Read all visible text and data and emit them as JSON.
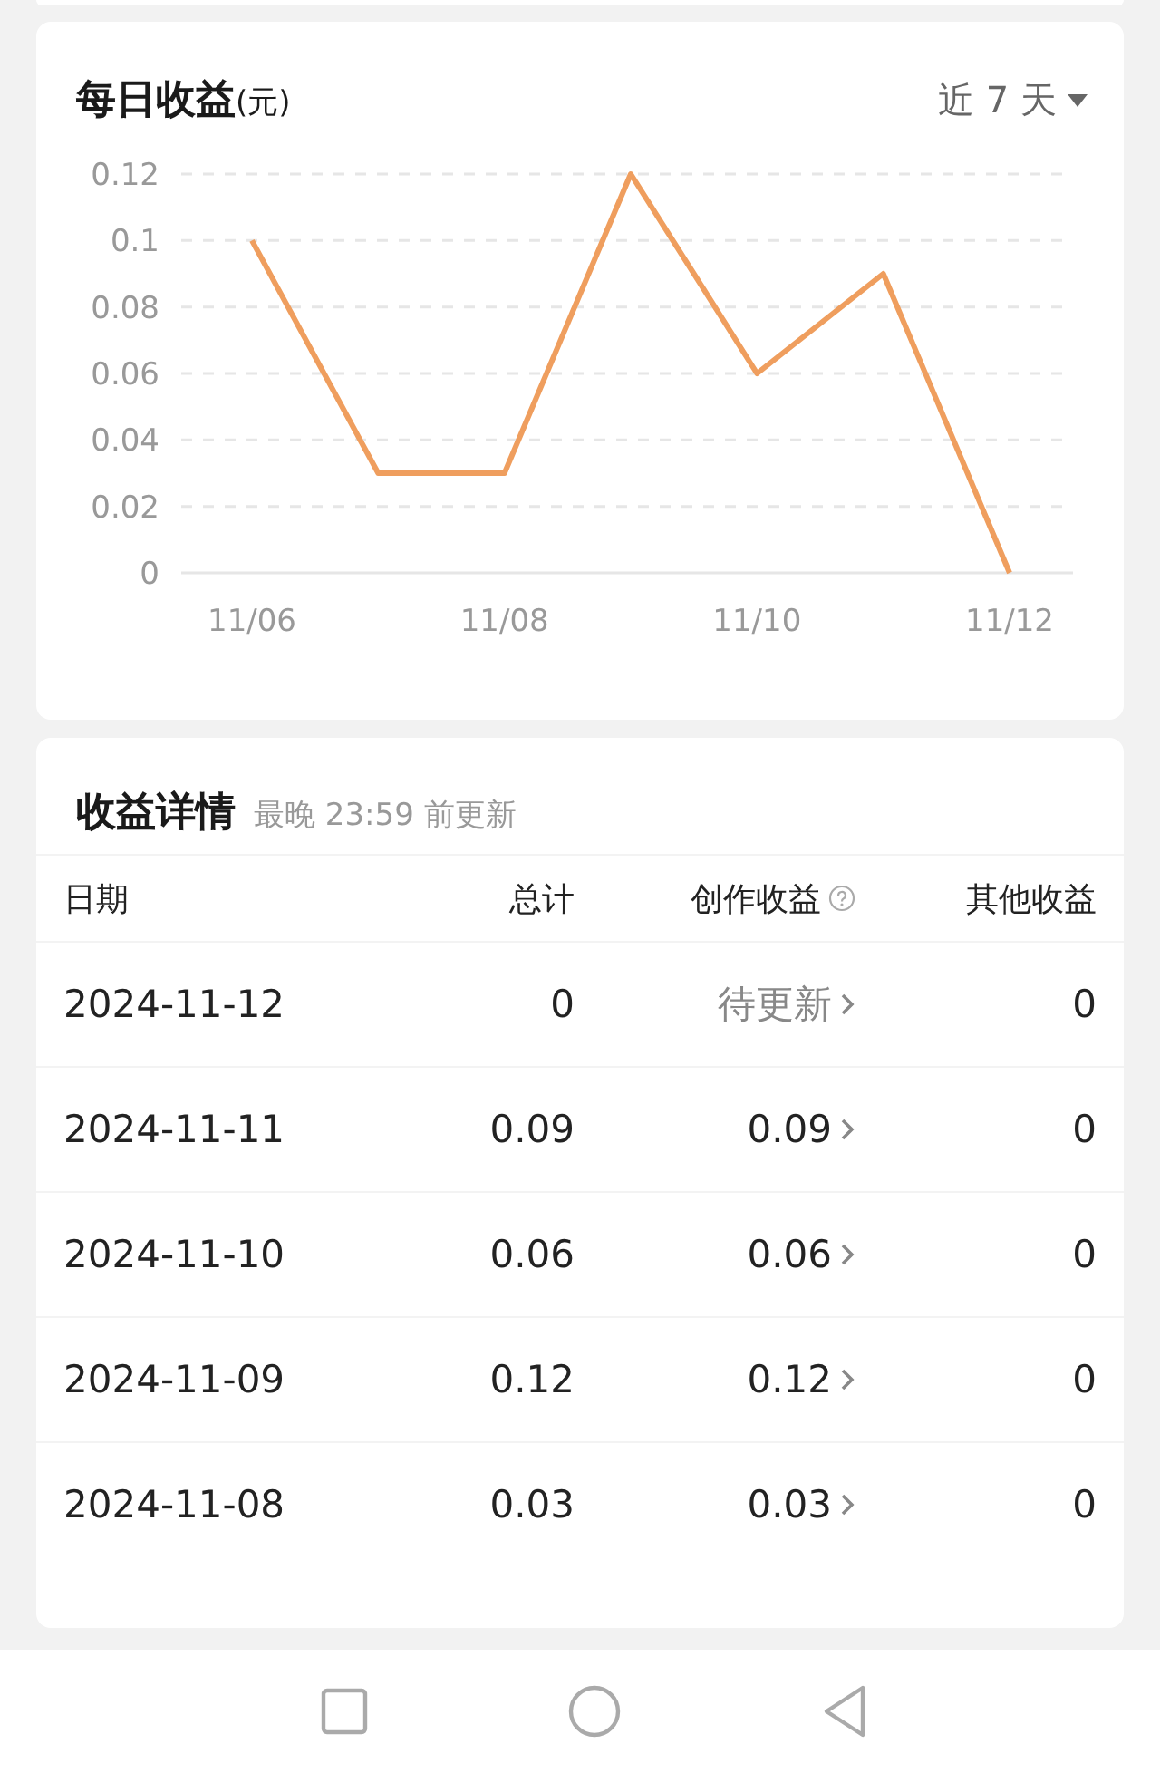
{
  "chart_card": {
    "title": "每日收益",
    "unit": "(元)",
    "range": "近 7 天",
    "chart_data": {
      "type": "line",
      "categories": [
        "11/06",
        null,
        "11/08",
        null,
        "11/10",
        null,
        "11/12"
      ],
      "grid": true,
      "series": [
        {
          "color": "#ef9e5e",
          "values": [
            0.1,
            0.03,
            0.03,
            0.12,
            0.06,
            0.09,
            0
          ]
        }
      ],
      "ylim": [
        0,
        0.12
      ],
      "yticks": [
        0,
        0.02,
        0.04,
        0.06,
        0.08,
        0.1,
        0.12
      ]
    }
  },
  "details": {
    "title": "收益详情",
    "note": "最晚 23:59 前更新",
    "columns": [
      "日期",
      "总计",
      "创作收益",
      "其他收益"
    ],
    "rows": [
      {
        "date": "2024-11-12",
        "total": "0",
        "creation": "待更新",
        "pending": true,
        "other": "0"
      },
      {
        "date": "2024-11-11",
        "total": "0.09",
        "creation": "0.09",
        "pending": false,
        "other": "0"
      },
      {
        "date": "2024-11-10",
        "total": "0.06",
        "creation": "0.06",
        "pending": false,
        "other": "0"
      },
      {
        "date": "2024-11-09",
        "total": "0.12",
        "creation": "0.12",
        "pending": false,
        "other": "0"
      },
      {
        "date": "2024-11-08",
        "total": "0.03",
        "creation": "0.03",
        "pending": false,
        "other": "0"
      }
    ]
  }
}
